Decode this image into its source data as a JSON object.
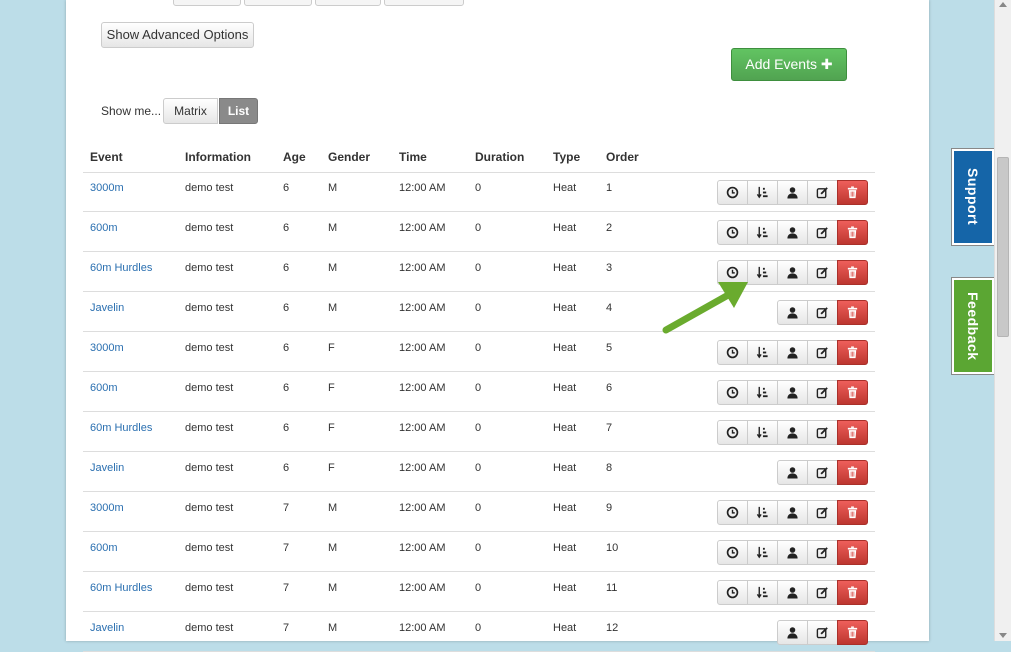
{
  "toolbar": {
    "advanced_options_label": "Show Advanced Options",
    "add_events_label": "Add Events ✚",
    "show_me_label": "Show me...",
    "view_matrix_label": "Matrix",
    "view_list_label": "List",
    "active_view": "List"
  },
  "table": {
    "headers": [
      "Event",
      "Information",
      "Age",
      "Gender",
      "Time",
      "Duration",
      "Type",
      "Order"
    ],
    "rows": [
      {
        "event": "3000m",
        "info": "demo test",
        "age": "6",
        "gender": "M",
        "time": "12:00 AM",
        "duration": "0",
        "type": "Heat",
        "order": "1",
        "full_actions": true
      },
      {
        "event": "600m",
        "info": "demo test",
        "age": "6",
        "gender": "M",
        "time": "12:00 AM",
        "duration": "0",
        "type": "Heat",
        "order": "2",
        "full_actions": true
      },
      {
        "event": "60m Hurdles",
        "info": "demo test",
        "age": "6",
        "gender": "M",
        "time": "12:00 AM",
        "duration": "0",
        "type": "Heat",
        "order": "3",
        "full_actions": true
      },
      {
        "event": "Javelin",
        "info": "demo test",
        "age": "6",
        "gender": "M",
        "time": "12:00 AM",
        "duration": "0",
        "type": "Heat",
        "order": "4",
        "full_actions": false
      },
      {
        "event": "3000m",
        "info": "demo test",
        "age": "6",
        "gender": "F",
        "time": "12:00 AM",
        "duration": "0",
        "type": "Heat",
        "order": "5",
        "full_actions": true
      },
      {
        "event": "600m",
        "info": "demo test",
        "age": "6",
        "gender": "F",
        "time": "12:00 AM",
        "duration": "0",
        "type": "Heat",
        "order": "6",
        "full_actions": true
      },
      {
        "event": "60m Hurdles",
        "info": "demo test",
        "age": "6",
        "gender": "F",
        "time": "12:00 AM",
        "duration": "0",
        "type": "Heat",
        "order": "7",
        "full_actions": true
      },
      {
        "event": "Javelin",
        "info": "demo test",
        "age": "6",
        "gender": "F",
        "time": "12:00 AM",
        "duration": "0",
        "type": "Heat",
        "order": "8",
        "full_actions": false
      },
      {
        "event": "3000m",
        "info": "demo test",
        "age": "7",
        "gender": "M",
        "time": "12:00 AM",
        "duration": "0",
        "type": "Heat",
        "order": "9",
        "full_actions": true
      },
      {
        "event": "600m",
        "info": "demo test",
        "age": "7",
        "gender": "M",
        "time": "12:00 AM",
        "duration": "0",
        "type": "Heat",
        "order": "10",
        "full_actions": true
      },
      {
        "event": "60m Hurdles",
        "info": "demo test",
        "age": "7",
        "gender": "M",
        "time": "12:00 AM",
        "duration": "0",
        "type": "Heat",
        "order": "11",
        "full_actions": true
      },
      {
        "event": "Javelin",
        "info": "demo test",
        "age": "7",
        "gender": "M",
        "time": "12:00 AM",
        "duration": "0",
        "type": "Heat",
        "order": "12",
        "full_actions": false
      }
    ],
    "action_icons": [
      "clock-icon",
      "sort-order-icon",
      "user-icon",
      "edit-icon",
      "trash-icon"
    ]
  },
  "side_tabs": {
    "support_label": "Support",
    "feedback_label": "Feedback"
  },
  "colors": {
    "link": "#2a6fb0",
    "add_button": "#5cb85c",
    "delete_button": "#d9534f",
    "support_tab": "#1565a8",
    "feedback_tab": "#5ba633",
    "annotation_arrow": "#6aab2e",
    "page_background": "#bcdde8"
  }
}
